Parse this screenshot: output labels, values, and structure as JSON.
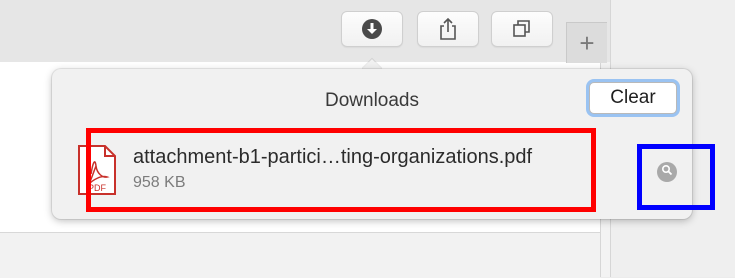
{
  "toolbar": {
    "buttons": [
      {
        "name": "downloads-button",
        "icon": "download-icon"
      },
      {
        "name": "share-button",
        "icon": "share-icon"
      },
      {
        "name": "tabs-overview-button",
        "icon": "tabs-icon"
      }
    ],
    "new_tab_label": "+"
  },
  "downloads_popover": {
    "title": "Downloads",
    "clear_label": "Clear",
    "items": [
      {
        "file_name": "attachment-b1-partici…ting-organizations.pdf",
        "size": "958 KB",
        "icon": "pdf-file-icon",
        "icon_label": "PDF",
        "reveal_icon": "magnifier-icon"
      }
    ]
  },
  "annotations": {
    "highlight_colors": [
      "#ff0000",
      "#0000ff"
    ]
  }
}
